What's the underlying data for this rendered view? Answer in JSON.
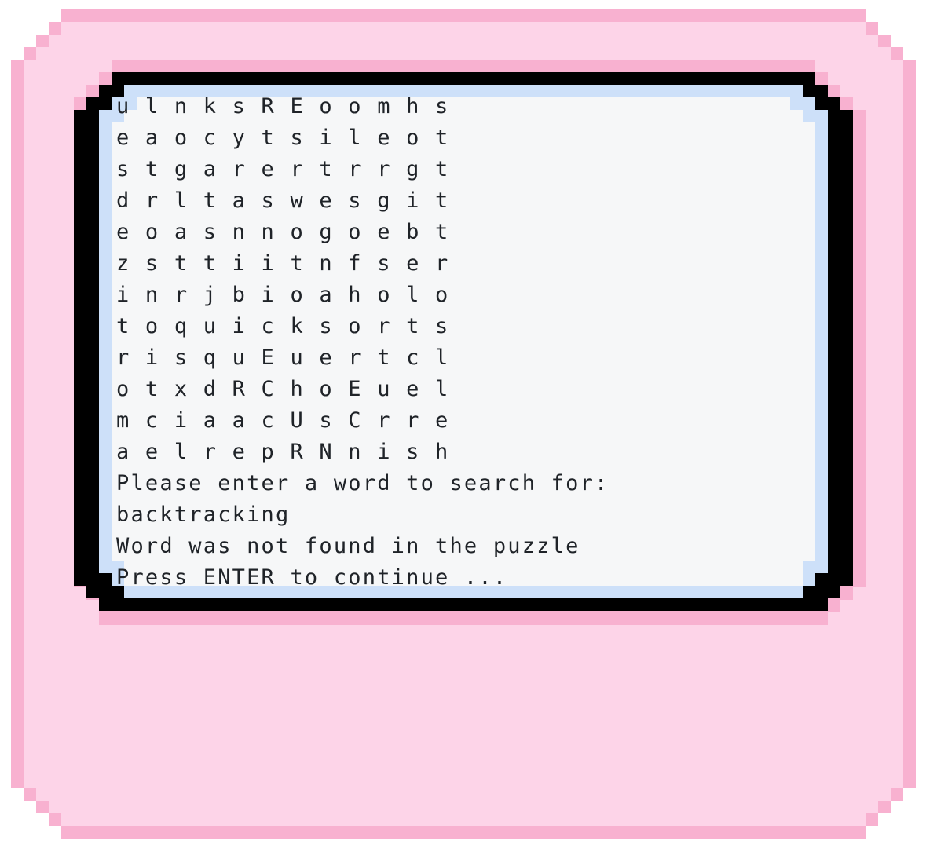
{
  "colors": {
    "outer_pink": "#f8b1d0",
    "inner_pink": "#fdd4e8",
    "screen_bezel": "#000000",
    "screen_edge": "#cde0f9",
    "screen_bg": "#f6f7f8",
    "text": "#1f2328"
  },
  "terminal": {
    "grid_rows": [
      "u l n k s R E o o m h s",
      "e a o c y t s i l e o t",
      "s t g a r e r t r r g t",
      "d r l t a s w e s g i t",
      "e o a s n n o g o e b t",
      "z s t t i i t n f s e r",
      "i n r j b i o a h o l o",
      "t o q u i c k s o r t s",
      "r i s q u E u e r t c l",
      "o t x d R C h o E u e l",
      "m c i a a c U s C r r e",
      "a e l r e p R N n i s h"
    ],
    "prompt": "Please enter a word to search for:",
    "input_value": "backtracking",
    "result": "Word was not found in the puzzle",
    "continue_hint": "Press ENTER to continue ..."
  }
}
